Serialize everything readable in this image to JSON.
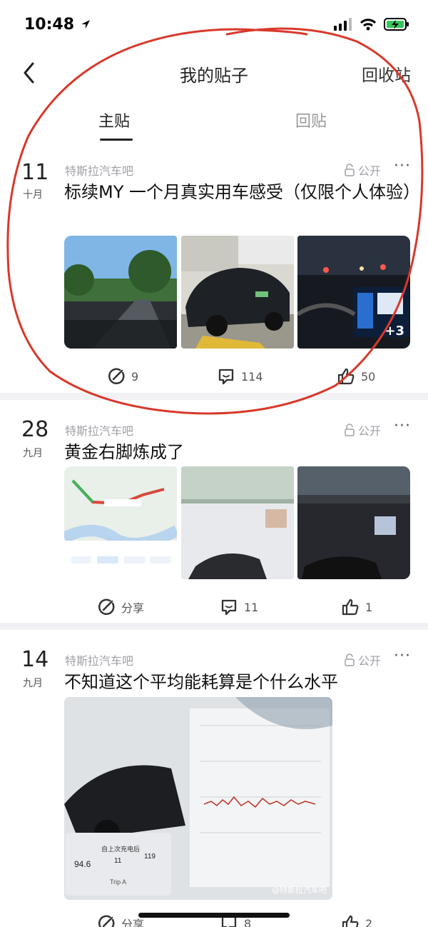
{
  "status": {
    "time": "10:48"
  },
  "nav": {
    "title": "我的贴子",
    "recycle": "回收站"
  },
  "tabs": {
    "main": "主贴",
    "reply": "回贴"
  },
  "posts": [
    {
      "day": "11",
      "month": "十月",
      "forum": "特斯拉汽车吧",
      "privacy": "公开",
      "more": "···",
      "title": "标续MY 一个月真实用车感受（仅限个人体验）",
      "extra_images": "+3",
      "share": "9",
      "comments": "114",
      "likes": "50"
    },
    {
      "day": "28",
      "month": "九月",
      "forum": "特斯拉汽车吧",
      "privacy": "公开",
      "more": "···",
      "title": "黄金右脚炼成了",
      "share": "分享",
      "comments": "11",
      "likes": "1"
    },
    {
      "day": "14",
      "month": "九月",
      "forum": "特斯拉汽车吧",
      "privacy": "公开",
      "more": "···",
      "title": "不知道这个平均能耗算是个什么水平",
      "watermark": "@特斯拉汽车吧",
      "share": "分享",
      "comments": "8",
      "likes": "2"
    }
  ],
  "screen_text": {
    "map_dist": "4.5公里 11分钟",
    "route_pref": "路线偏好",
    "trip": "Trip A",
    "energy_a": "94.6",
    "energy_b": "11",
    "energy_c": "119",
    "since_charge": "自上次充电后",
    "qq_music": "QQ音乐",
    "open": "打开"
  },
  "colors": {
    "annotation": "#d9382a",
    "text_muted": "#a0a0a8",
    "divider": "#f2f2f4"
  }
}
